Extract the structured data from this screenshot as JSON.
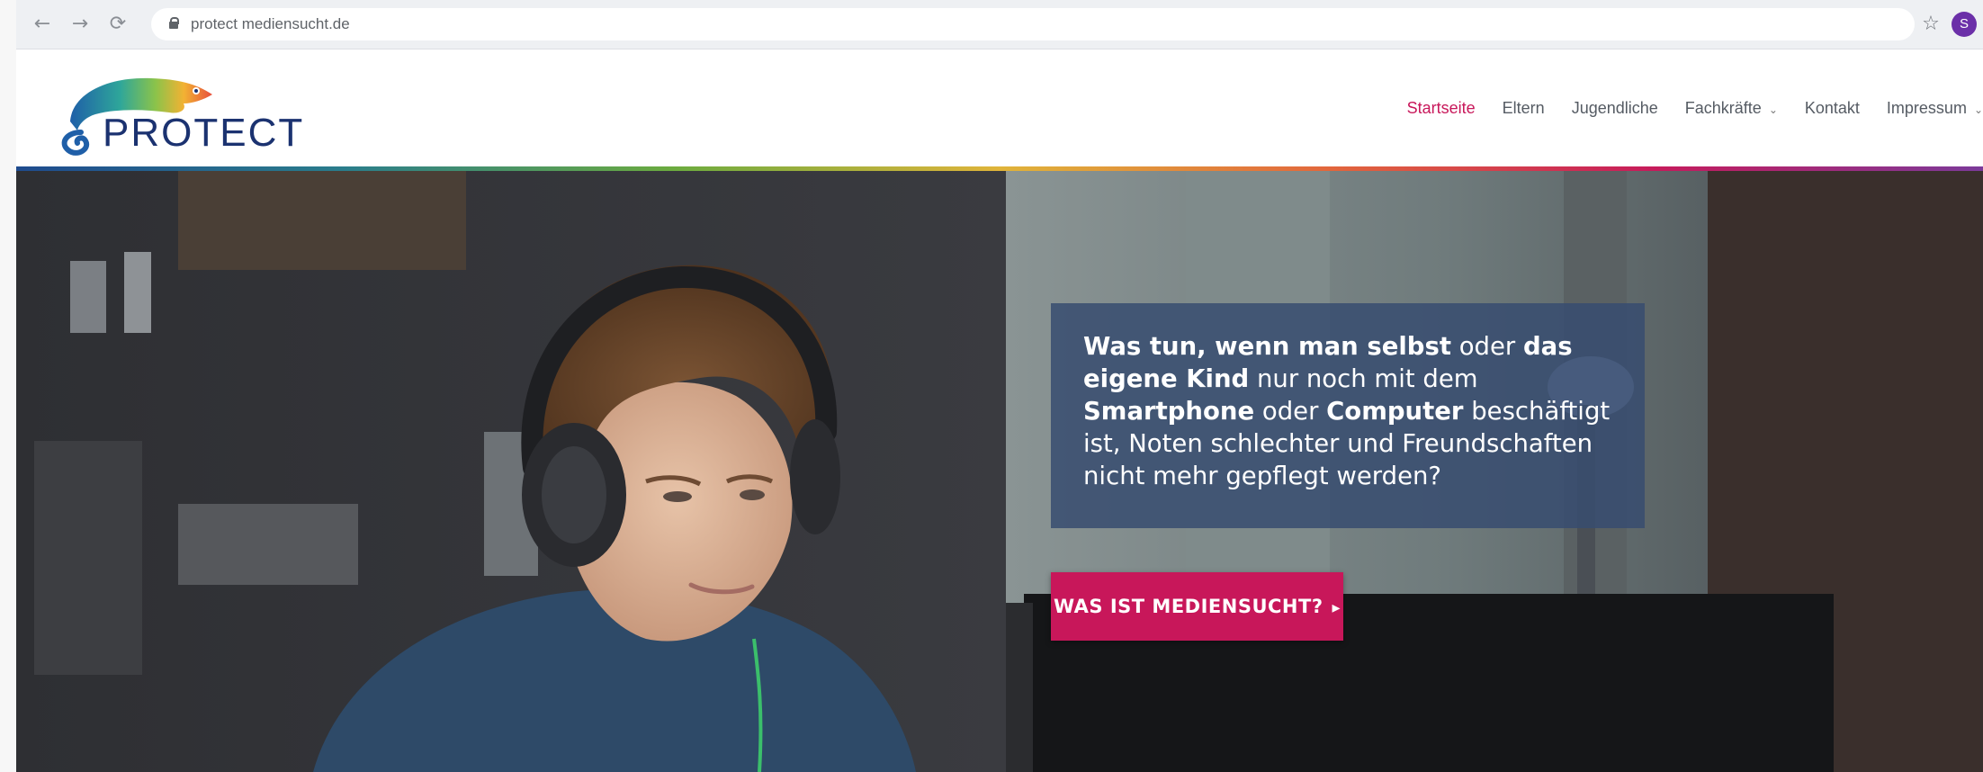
{
  "browser": {
    "back_icon": "←",
    "forward_icon": "→",
    "reload_icon": "⟳",
    "url": "protect mediensucht.de",
    "star_icon": "☆",
    "extension_label": "S"
  },
  "site": {
    "logo_text": "PROTECT",
    "nav": [
      {
        "label": "Startseite",
        "active": true
      },
      {
        "label": "Eltern"
      },
      {
        "label": "Jugendliche"
      },
      {
        "label": "Fachkräfte",
        "dropdown_icon": "⌄"
      },
      {
        "label": "Kontakt"
      },
      {
        "label": "Impressum",
        "dropdown_icon": "⌄"
      }
    ]
  },
  "hero": {
    "text": {
      "p1": "Was tun, wenn man selbst",
      "p2": " oder ",
      "p3": "das eigene Kind",
      "p4": " nur noch mit dem ",
      "p5": "Smartphone",
      "p6": " oder ",
      "p7": "Computer",
      "p8": " beschäftigt ist, Noten schlechter und Freundschaften nicht mehr gepflegt werden?"
    },
    "cta_label": "WAS IST MEDIENSUCHT?",
    "cta_arrow": "▸"
  },
  "colors": {
    "accent": "#c8175a",
    "navy": "#1b3270",
    "overlay": "#374c70"
  }
}
